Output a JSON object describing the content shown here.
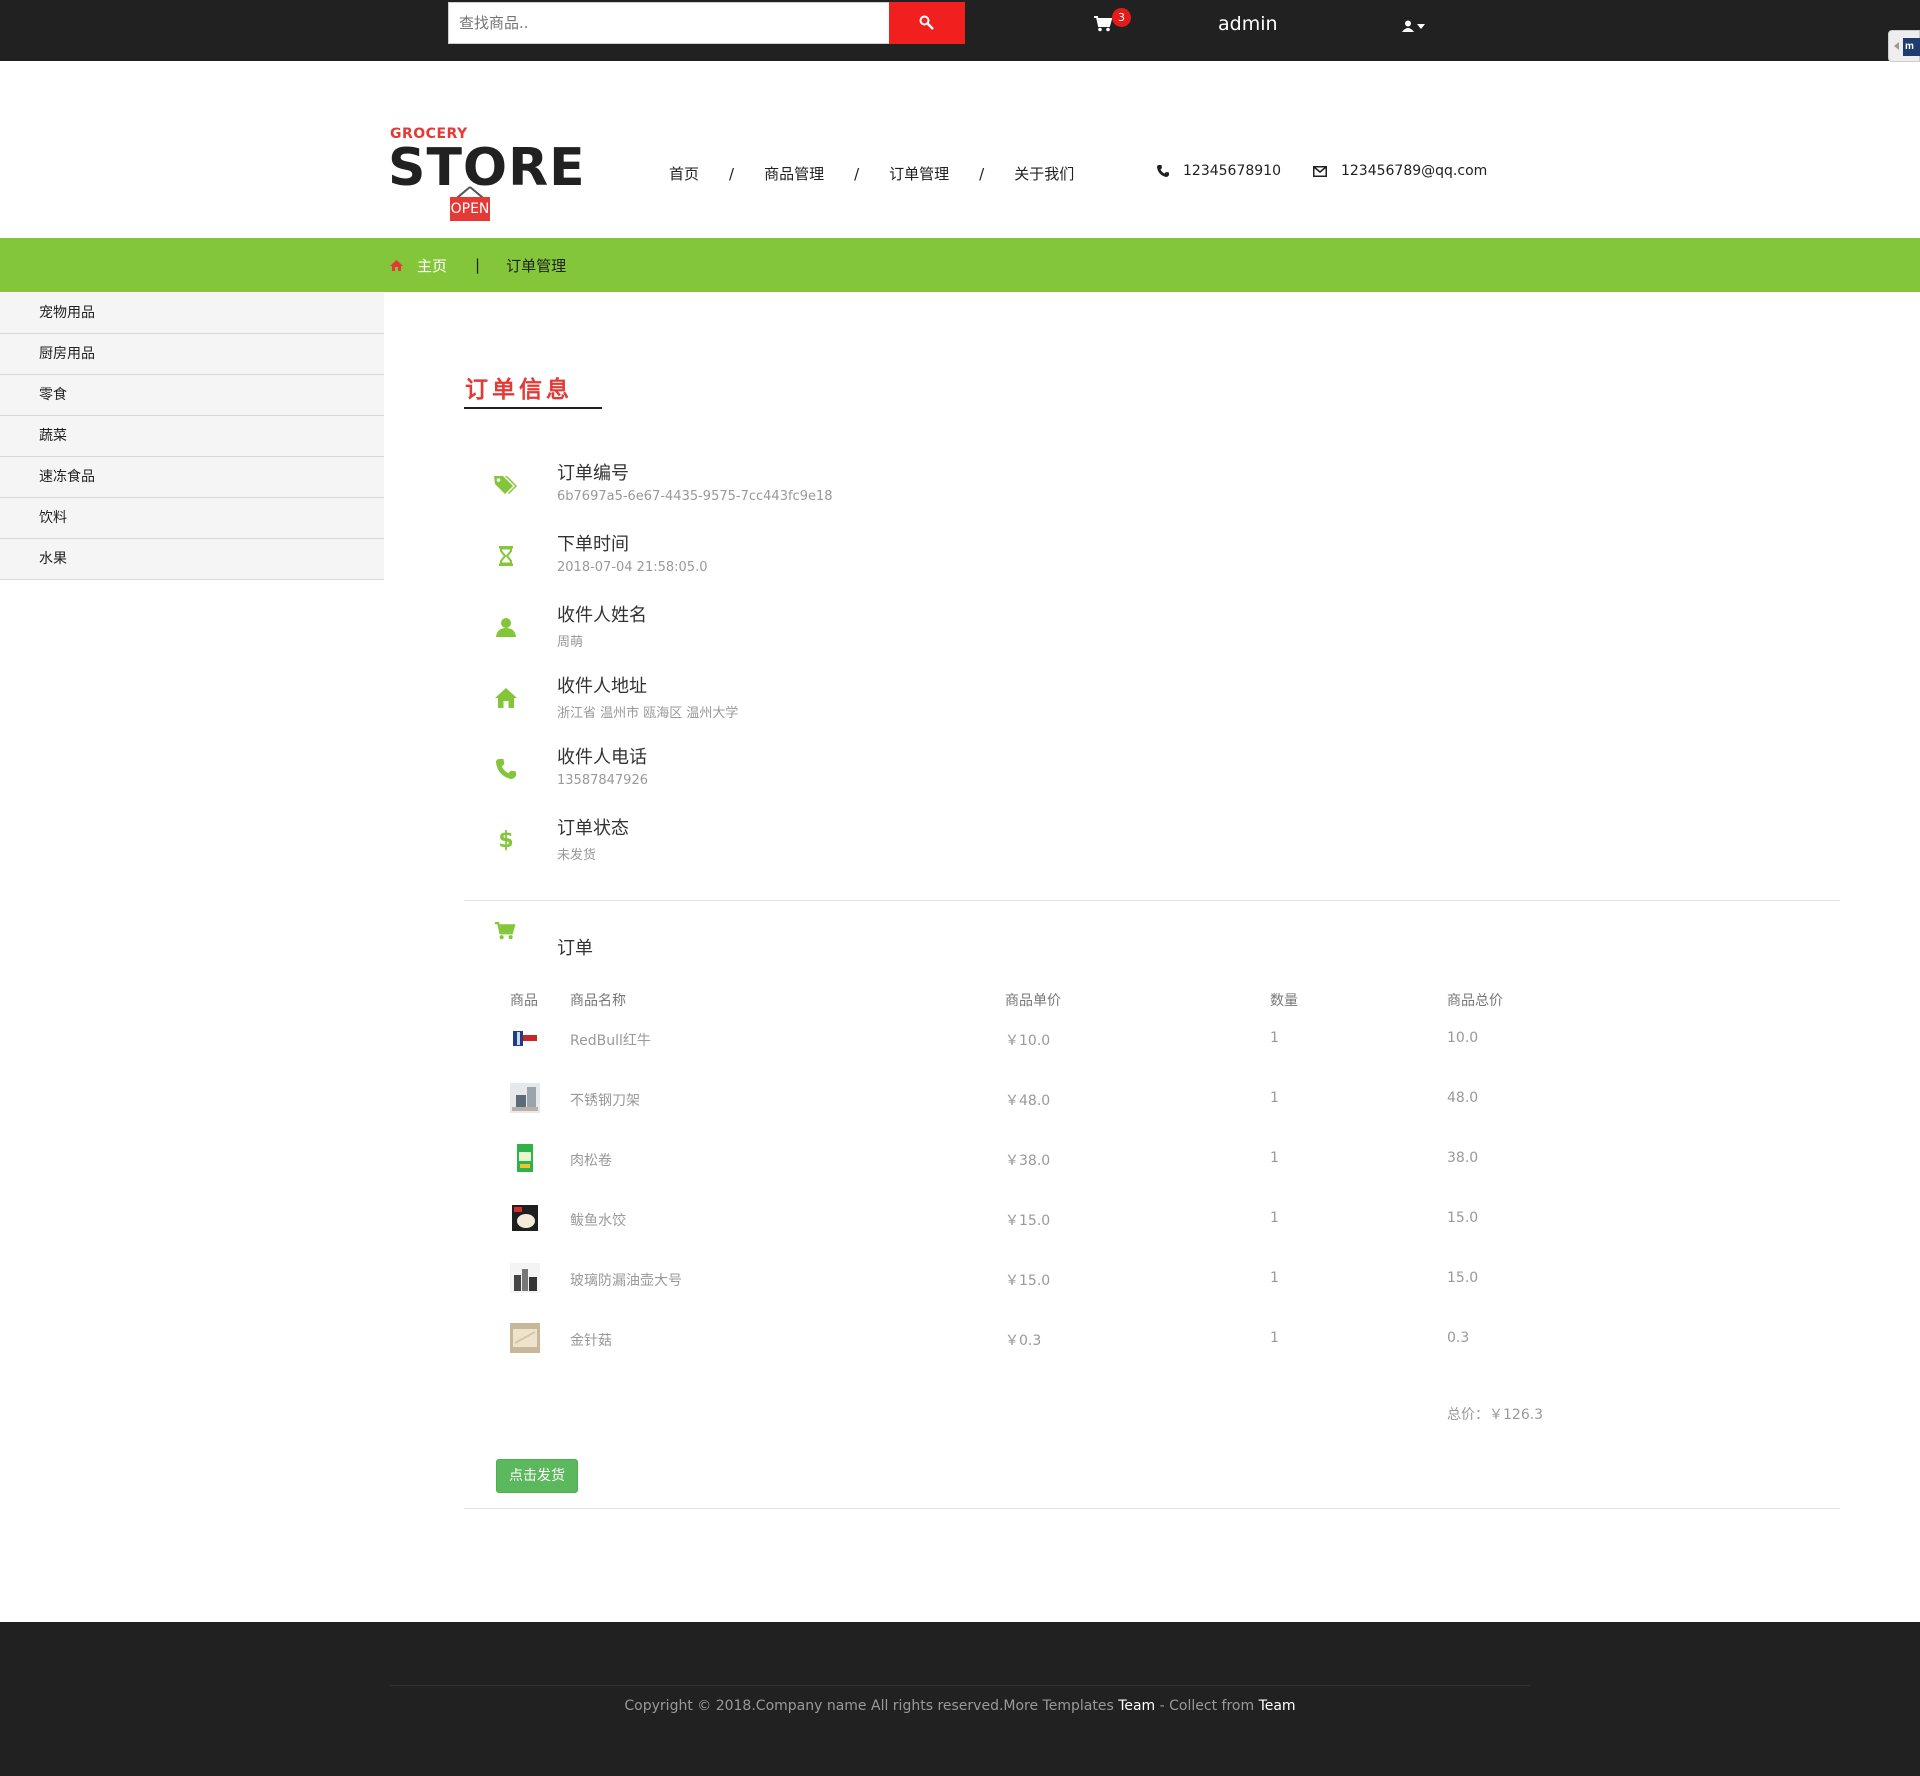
{
  "topbar": {
    "search_placeholder": "查找商品..",
    "cart_count": "3",
    "username": "admin"
  },
  "logo": {
    "line1": "GROCERY",
    "line2": "STORE",
    "sign": "OPEN"
  },
  "nav": {
    "items": [
      {
        "label": "首页"
      },
      {
        "label": "商品管理"
      },
      {
        "label": "订单管理"
      },
      {
        "label": "关于我们"
      }
    ],
    "separator": "/"
  },
  "contact": {
    "phone": "12345678910",
    "email": "123456789@qq.com"
  },
  "breadcrumb": {
    "home": "主页",
    "separator": "|",
    "current": "订单管理"
  },
  "sidebar": {
    "items": [
      {
        "label": "宠物用品"
      },
      {
        "label": "厨房用品"
      },
      {
        "label": "零食"
      },
      {
        "label": "蔬菜"
      },
      {
        "label": "速冻食品"
      },
      {
        "label": "饮料"
      },
      {
        "label": "水果"
      }
    ]
  },
  "order_info": {
    "title": "订单信息",
    "fields": [
      {
        "icon": "tags-icon",
        "label": "订单编号",
        "value": "6b7697a5-6e67-4435-9575-7cc443fc9e18"
      },
      {
        "icon": "hourglass-icon",
        "label": "下单时间",
        "value": "2018-07-04 21:58:05.0"
      },
      {
        "icon": "user-icon",
        "label": "收件人姓名",
        "value": "周萌"
      },
      {
        "icon": "home-icon",
        "label": "收件人地址",
        "value": "浙江省 温州市 瓯海区 温州大学"
      },
      {
        "icon": "phone-icon",
        "label": "收件人电话",
        "value": "13587847926"
      },
      {
        "icon": "dollar-icon",
        "label": "订单状态",
        "value": "未发货"
      }
    ]
  },
  "order": {
    "title": "订单",
    "headers": [
      "商品",
      "商品名称",
      "商品单价",
      "数量",
      "商品总价"
    ],
    "rows": [
      {
        "name": "RedBull红牛",
        "price": "￥10.0",
        "qty": "1",
        "total": "10.0",
        "thumb": "redbull-thumb"
      },
      {
        "name": "不锈钢刀架",
        "price": "￥48.0",
        "qty": "1",
        "total": "48.0",
        "thumb": "knife-rack-thumb"
      },
      {
        "name": "肉松卷",
        "price": "￥38.0",
        "qty": "1",
        "total": "38.0",
        "thumb": "meat-floss-roll-thumb"
      },
      {
        "name": "鲅鱼水饺",
        "price": "￥15.0",
        "qty": "1",
        "total": "15.0",
        "thumb": "dumpling-thumb"
      },
      {
        "name": "玻璃防漏油壶大号",
        "price": "￥15.0",
        "qty": "1",
        "total": "15.0",
        "thumb": "oil-pot-thumb"
      },
      {
        "name": "金针菇",
        "price": "￥0.3",
        "qty": "1",
        "total": "0.3",
        "thumb": "enoki-thumb"
      }
    ],
    "total_label": "总价：￥126.3",
    "ship_button": "点击发货"
  },
  "footer": {
    "text_before": "Copyright © 2018.Company name All rights reserved.More Templates ",
    "link1": "Team",
    "text_middle": " - Collect from ",
    "link2": "Team"
  },
  "colors": {
    "accent_green": "#84c639",
    "accent_red": "#e53935",
    "dark": "#212121",
    "button_green": "#5cb85c"
  }
}
